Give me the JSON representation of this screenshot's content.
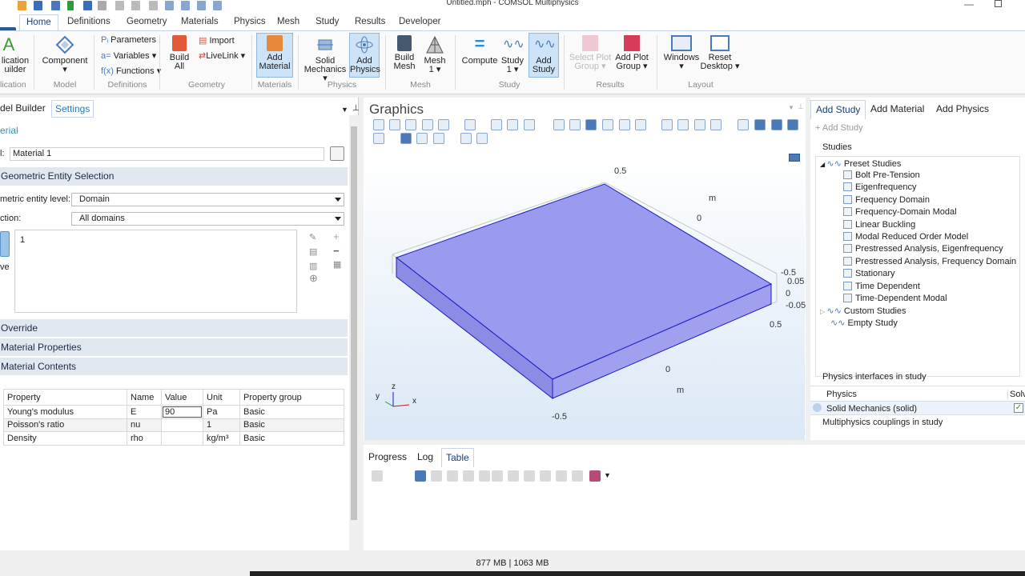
{
  "window": {
    "title": "Untitled.mph - COMSOL Multiphysics"
  },
  "ribbon_tabs": [
    "Home",
    "Definitions",
    "Geometry",
    "Materials",
    "Physics",
    "Mesh",
    "Study",
    "Results",
    "Developer"
  ],
  "ribbon": {
    "application_builder": {
      "line1": "lication",
      "line2": "uilder"
    },
    "component": "Component",
    "parameters": "Parameters",
    "variables": "Variables",
    "functions": "Functions",
    "build_all": {
      "line1": "Build",
      "line2": "All"
    },
    "import": "Import",
    "livelink": "LiveLink",
    "add_material": {
      "line1": "Add",
      "line2": "Material"
    },
    "solid_mechanics": {
      "line1": "Solid",
      "line2": "Mechanics"
    },
    "add_physics": {
      "line1": "Add",
      "line2": "Physics"
    },
    "build_mesh": {
      "line1": "Build",
      "line2": "Mesh"
    },
    "mesh1": {
      "line1": "Mesh",
      "line2": "1"
    },
    "compute": "Compute",
    "study1": {
      "line1": "Study",
      "line2": "1"
    },
    "add_study": {
      "line1": "Add",
      "line2": "Study"
    },
    "select_plot_group": {
      "line1": "Select Plot",
      "line2": "Group"
    },
    "add_plot_group": {
      "line1": "Add Plot",
      "line2": "Group"
    },
    "windows": "Windows",
    "reset_desktop": {
      "line1": "Reset",
      "line2": "Desktop"
    },
    "groups": [
      "lication",
      "Model",
      "Definitions",
      "Geometry",
      "Materials",
      "Physics",
      "Mesh",
      "Study",
      "Results",
      "Layout"
    ]
  },
  "left_panel": {
    "tabs": [
      "del Builder",
      "Settings"
    ],
    "section_title": "erial",
    "label_field": {
      "label": "l:",
      "value": "Material 1"
    },
    "geometric_entity_selection": "Geometric Entity Selection",
    "entity_level": {
      "label": "metric entity level:",
      "value": "Domain"
    },
    "selection": {
      "label": "ction:",
      "value": "All domains"
    },
    "selection_list": [
      "1"
    ],
    "side_label": "ve",
    "override": "Override",
    "material_properties": "Material Properties",
    "material_contents": "Material Contents",
    "table": {
      "headers": [
        "Property",
        "Name",
        "Value",
        "Unit",
        "Property group"
      ],
      "rows": [
        [
          "Young's modulus",
          "E",
          "90",
          "Pa",
          "Basic"
        ],
        [
          "Poisson's ratio",
          "nu",
          "",
          "1",
          "Basic"
        ],
        [
          "Density",
          "rho",
          "",
          "kg/m³",
          "Basic"
        ]
      ]
    }
  },
  "graphics": {
    "title": "Graphics",
    "axis_labels": [
      "0.5",
      "m",
      "0",
      "-0.5",
      "0.05",
      "0",
      "-0.05",
      "0.5",
      "0",
      "m",
      "-0.5"
    ],
    "triad": [
      "z",
      "y",
      "x"
    ],
    "block_color": "#9a9aee"
  },
  "bottom_panel": {
    "tabs": [
      "Progress",
      "Log",
      "Table"
    ]
  },
  "right_panel": {
    "tabs": [
      "Add Study",
      "Add Material",
      "Add Physics"
    ],
    "add_study_button": "Add Study",
    "studies_label": "Studies",
    "preset_studies": "Preset Studies",
    "studies": [
      "Bolt Pre-Tension",
      "Eigenfrequency",
      "Frequency Domain",
      "Frequency-Domain Modal",
      "Linear Buckling",
      "Modal Reduced Order Model",
      "Prestressed Analysis, Eigenfrequency",
      "Prestressed Analysis, Frequency Domain",
      "Stationary",
      "Time Dependent",
      "Time-Dependent Modal"
    ],
    "custom_studies": "Custom Studies",
    "empty_study": "Empty Study",
    "physics_interfaces_label": "Physics interfaces in study",
    "physics_col": "Physics",
    "solve_col": "Solv",
    "physics_row": "Solid Mechanics (solid)",
    "multiphysics_label": "Multiphysics couplings in study"
  },
  "status": {
    "memory": "877 MB | 1063 MB"
  }
}
